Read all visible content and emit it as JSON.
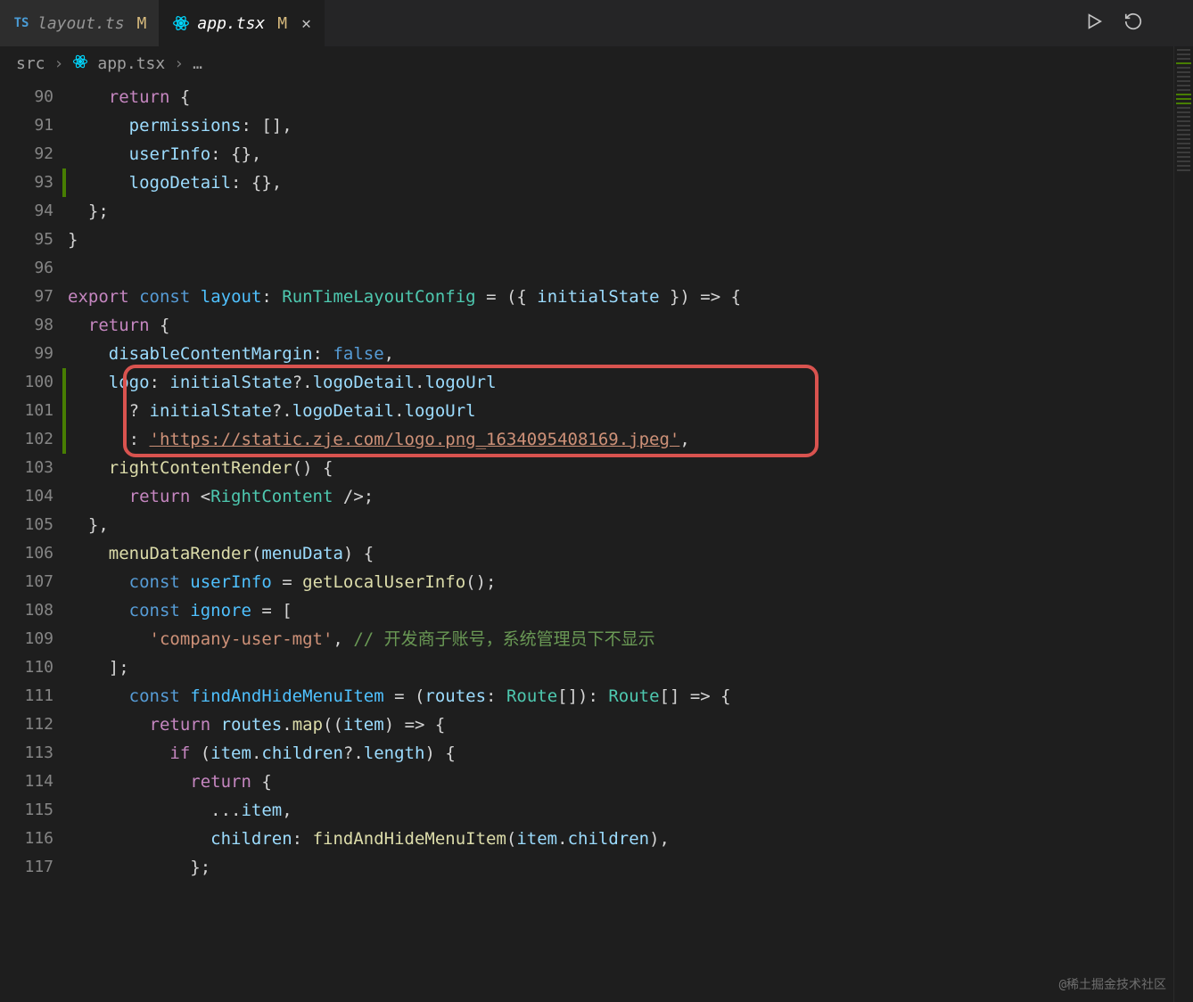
{
  "tabs": [
    {
      "icon": "ts",
      "name": "layout.ts",
      "modified": "M",
      "active": false
    },
    {
      "icon": "react",
      "name": "app.tsx",
      "modified": "M",
      "active": true
    }
  ],
  "breadcrumb": {
    "part1": "src",
    "part2": "app.tsx",
    "more": "…"
  },
  "gutter": [
    "90",
    "91",
    "92",
    "93",
    "94",
    "95",
    "96",
    "97",
    "98",
    "99",
    "100",
    "101",
    "102",
    "103",
    "104",
    "105",
    "106",
    "107",
    "108",
    "109",
    "110",
    "111",
    "112",
    "113",
    "114",
    "115",
    "116",
    "117"
  ],
  "code": {
    "l90": {
      "kw": "return",
      "rest": " {"
    },
    "l91": {
      "prop": "permissions",
      "rest": ": [],"
    },
    "l92": {
      "prop": "userInfo",
      "rest": ": {},"
    },
    "l93": {
      "prop": "logoDetail",
      "rest": ": {},"
    },
    "l94": "  };",
    "l95": "}",
    "l96": "",
    "l97": {
      "export": "export",
      "const": "const",
      "name": "layout",
      "type": "RunTimeLayoutConfig",
      "param": "initialState",
      "arrow": " = ({ ",
      "end": " }) => {"
    },
    "l98": {
      "kw": "return",
      "rest": " {"
    },
    "l99": {
      "prop": "disableContentMargin",
      "val": "false",
      "comma": ","
    },
    "l100": {
      "prop": "logo",
      "expr1": "initialState",
      "opt": "?.",
      "p2": "logoDetail",
      "dot": ".",
      "p3": "logoUrl"
    },
    "l101": {
      "q": "? ",
      "expr1": "initialState",
      "opt": "?.",
      "p2": "logoDetail",
      "dot": ".",
      "p3": "logoUrl"
    },
    "l102": {
      "colon": ": ",
      "str": "'https://static.zje.com/logo.png_1634095408169.jpeg'",
      "comma": ","
    },
    "l103": {
      "fn": "rightContentRender",
      "rest": "() {"
    },
    "l104": {
      "kw": "return",
      "open": " <",
      "comp": "RightContent",
      "close": " />;"
    },
    "l105": "  },",
    "l106": {
      "fn": "menuDataRender",
      "param": "menuData",
      "rest": ") {"
    },
    "l107": {
      "const": "const",
      "name": "userInfo",
      "eq": " = ",
      "fn": "getLocalUserInfo",
      "rest": "();"
    },
    "l108": {
      "const": "const",
      "name": "ignore",
      "eq": " = ["
    },
    "l109": {
      "str": "'company-user-mgt'",
      "comma": ", ",
      "comment": "// 开发商子账号，系统管理员下不显示"
    },
    "l110": "    ];",
    "l111": {
      "const": "const",
      "name": "findAndHideMenuItem",
      "eq": " = (",
      "param": "routes",
      "t": ": ",
      "type": "Route",
      "br": "[]): ",
      "type2": "Route",
      "br2": "[] => {"
    },
    "l112": {
      "kw": "return",
      "sp": " ",
      "obj": "routes",
      "dot": ".",
      "fn": "map",
      "rest": "((",
      "param": "item",
      "rest2": ") => {"
    },
    "l113": {
      "kw": "if",
      "rest": " (",
      "obj": "item",
      "dot": ".",
      "prop": "children",
      "opt": "?.",
      "prop2": "length",
      "rest2": ") {"
    },
    "l114": {
      "kw": "return",
      "rest": " {"
    },
    "l115": {
      "spread": "...",
      "var": "item",
      "comma": ","
    },
    "l116": {
      "prop": "children",
      "colon": ": ",
      "fn": "findAndHideMenuItem",
      "rest": "(",
      "obj": "item",
      "dot": ".",
      "prop2": "children",
      "rest2": "),"
    },
    "l117": "            };"
  },
  "watermark": "@稀土掘金技术社区"
}
